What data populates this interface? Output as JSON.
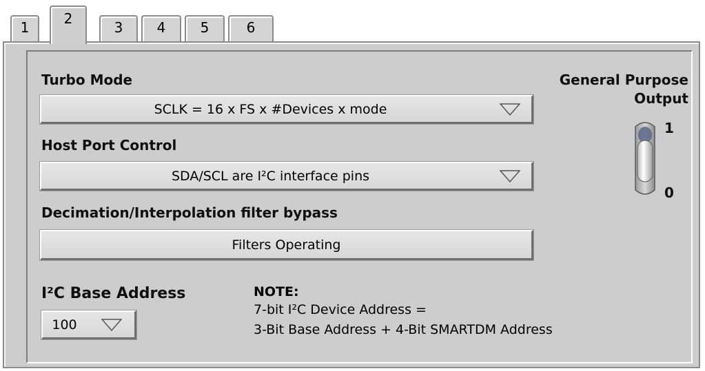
{
  "tabs": [
    {
      "label": "1",
      "active": false
    },
    {
      "label": "2",
      "active": true
    },
    {
      "label": "3",
      "active": false
    },
    {
      "label": "4",
      "active": false
    },
    {
      "label": "5",
      "active": false
    },
    {
      "label": "6",
      "active": false
    }
  ],
  "turbo_mode": {
    "label": "Turbo Mode",
    "value": "SCLK = 16 x FS x #Devices x mode"
  },
  "host_port": {
    "label": "Host Port Control",
    "value": "SDA/SCL are I²C interface pins"
  },
  "filter_bypass": {
    "label": "Decimation/Interpolation filter bypass",
    "value": "Filters Operating"
  },
  "i2c_base": {
    "label": "I²C Base Address",
    "value": "100"
  },
  "note": {
    "title": "NOTE:",
    "line1": "7-bit I²C Device Address =",
    "line2": "3-Bit Base Address + 4-Bit SMARTDM Address"
  },
  "gpo": {
    "label_line1": "General Purpose",
    "label_line2": "Output",
    "high_label": "1",
    "low_label": "0",
    "state": "0"
  },
  "icons": {
    "dropdown": "chevron-down-icon",
    "switch": "toggle-switch-icon"
  }
}
